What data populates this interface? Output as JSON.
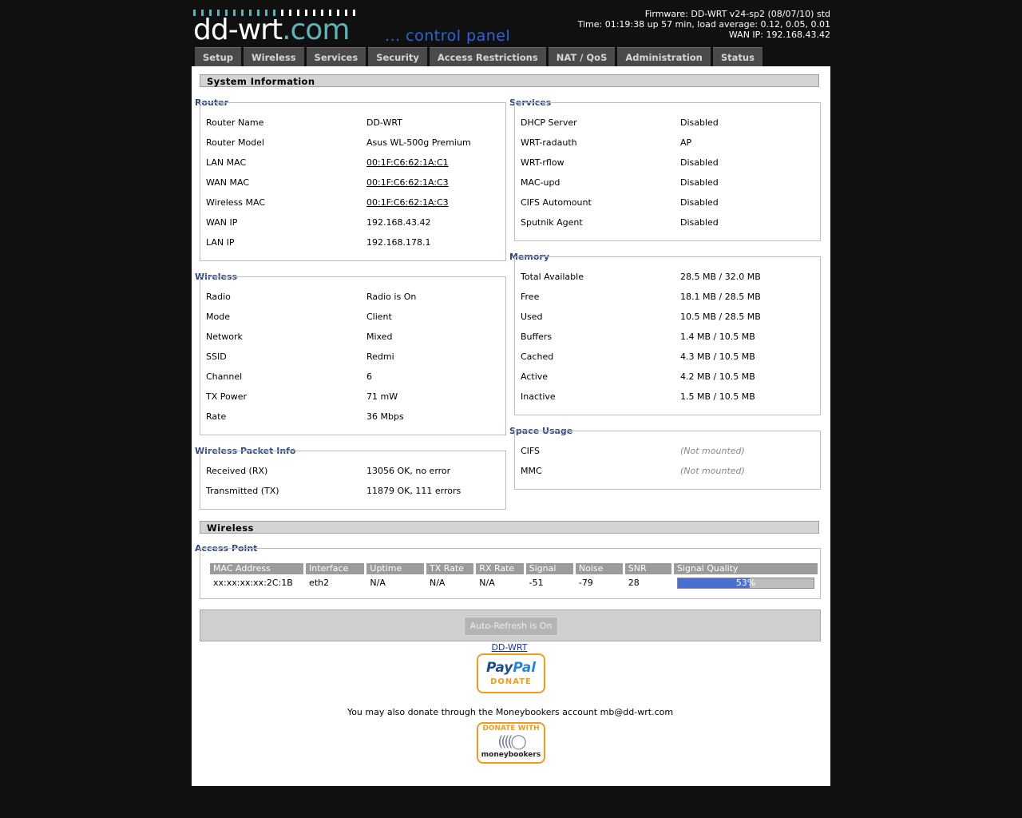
{
  "header": {
    "logo_dd": "dd-wrt",
    "logo_com": ".com",
    "logo_cp": "... control panel",
    "firmware": "Firmware: DD-WRT v24-sp2 (08/07/10) std",
    "time": "Time: 01:19:38 up 57 min, load average: 0.12, 0.05, 0.01",
    "wan_ip": "WAN IP: 192.168.43.42"
  },
  "tabs": [
    "Setup",
    "Wireless",
    "Services",
    "Security",
    "Access Restrictions",
    "NAT / QoS",
    "Administration",
    "Status"
  ],
  "sysinfo": {
    "title": "System Information",
    "router": {
      "legend": "Router",
      "rows": [
        {
          "label": "Router Name",
          "value": "DD-WRT"
        },
        {
          "label": "Router Model",
          "value": "Asus WL-500g Premium"
        },
        {
          "label": "LAN MAC",
          "value": "00:1F:C6:62:1A:C1"
        },
        {
          "label": "WAN MAC",
          "value": "00:1F:C6:62:1A:C3"
        },
        {
          "label": "Wireless MAC",
          "value": "00:1F:C6:62:1A:C3"
        },
        {
          "label": "WAN IP",
          "value": "192.168.43.42"
        },
        {
          "label": "LAN IP",
          "value": "192.168.178.1"
        }
      ]
    },
    "wireless": {
      "legend": "Wireless",
      "rows": [
        {
          "label": "Radio",
          "value": "Radio is On"
        },
        {
          "label": "Mode",
          "value": "Client"
        },
        {
          "label": "Network",
          "value": "Mixed"
        },
        {
          "label": "SSID",
          "value": "Redmi"
        },
        {
          "label": "Channel",
          "value": "6"
        },
        {
          "label": "TX Power",
          "value": "71 mW"
        },
        {
          "label": "Rate",
          "value": "36 Mbps"
        }
      ]
    },
    "packet": {
      "legend": "Wireless Packet Info",
      "rows": [
        {
          "label": "Received (RX)",
          "value": "13056 OK, no error"
        },
        {
          "label": "Transmitted (TX)",
          "value": "11879 OK, 111 errors"
        }
      ]
    },
    "services": {
      "legend": "Services",
      "rows": [
        {
          "label": "DHCP Server",
          "value": "Disabled"
        },
        {
          "label": "WRT-radauth",
          "value": "AP"
        },
        {
          "label": "WRT-rflow",
          "value": "Disabled"
        },
        {
          "label": "MAC-upd",
          "value": "Disabled"
        },
        {
          "label": "CIFS Automount",
          "value": "Disabled"
        },
        {
          "label": "Sputnik Agent",
          "value": "Disabled"
        }
      ]
    },
    "memory": {
      "legend": "Memory",
      "rows": [
        {
          "label": "Total Available",
          "value": "28.5 MB / 32.0 MB"
        },
        {
          "label": "Free",
          "value": "18.1 MB / 28.5 MB"
        },
        {
          "label": "Used",
          "value": "10.5 MB / 28.5 MB"
        },
        {
          "label": "Buffers",
          "value": "1.4 MB / 10.5 MB"
        },
        {
          "label": "Cached",
          "value": "4.3 MB / 10.5 MB"
        },
        {
          "label": "Active",
          "value": "4.2 MB / 10.5 MB"
        },
        {
          "label": "Inactive",
          "value": "1.5 MB / 10.5 MB"
        }
      ]
    },
    "space": {
      "legend": "Space Usage",
      "rows": [
        {
          "label": "CIFS",
          "value": "(Not mounted)"
        },
        {
          "label": "MMC",
          "value": "(Not mounted)"
        }
      ]
    }
  },
  "wireless_section": {
    "title": "Wireless",
    "ap_legend": "Access Point",
    "columns": [
      "MAC Address",
      "Interface",
      "Uptime",
      "TX Rate",
      "RX Rate",
      "Signal",
      "Noise",
      "SNR",
      "Signal Quality"
    ],
    "row": {
      "mac": "xx:xx:xx:xx:2C:1B",
      "interface": "eth2",
      "uptime": "N/A",
      "tx_rate": "N/A",
      "rx_rate": "N/A",
      "signal": "-51",
      "noise": "-79",
      "snr": "28",
      "quality_label": "53%",
      "quality_fraction": 0.53
    }
  },
  "footer": {
    "refresh_label": "Auto-Refresh is On",
    "link": "DD-WRT",
    "paypal_1": "Pay",
    "paypal_2": "Pal",
    "paypal_donate": "DONATE",
    "mb_text": "You may also donate through the Moneybookers account mb@dd-wrt.com",
    "mb_top": "DONATE WITH",
    "mb_bottom": "moneybookers"
  },
  "colors": {
    "page_bg": "#101010",
    "accent_blue": "#2e4a7e",
    "logo_teal": "#5fb3b3",
    "signal_fill": "#4a6fcf",
    "donate_orange": "#f29a1e"
  }
}
